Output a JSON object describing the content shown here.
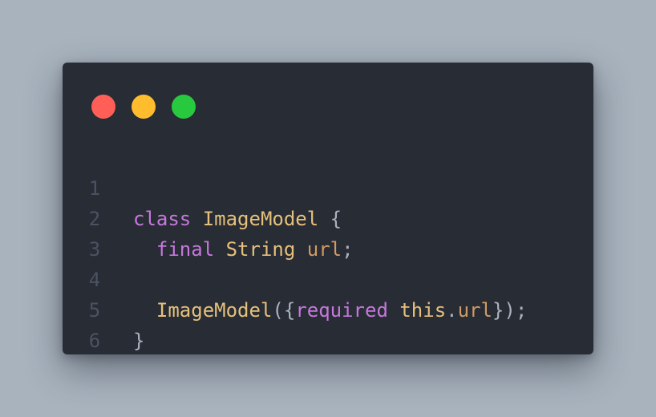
{
  "window": {
    "buttons": {
      "close_color": "#ff5f56",
      "minimize_color": "#ffbd2e",
      "maximize_color": "#27c93f"
    }
  },
  "code": {
    "lines": [
      {
        "number": "1",
        "tokens": [
          {
            "text": "class",
            "type": "keyword"
          },
          {
            "text": " ",
            "type": "plain"
          },
          {
            "text": "ImageModel",
            "type": "type"
          },
          {
            "text": " {",
            "type": "punct"
          }
        ]
      },
      {
        "number": "2",
        "tokens": [
          {
            "text": "  ",
            "type": "plain"
          },
          {
            "text": "final",
            "type": "keyword"
          },
          {
            "text": " ",
            "type": "plain"
          },
          {
            "text": "String",
            "type": "type"
          },
          {
            "text": " ",
            "type": "plain"
          },
          {
            "text": "url",
            "type": "field"
          },
          {
            "text": ";",
            "type": "punct"
          }
        ]
      },
      {
        "number": "3",
        "tokens": []
      },
      {
        "number": "4",
        "tokens": [
          {
            "text": "  ",
            "type": "plain"
          },
          {
            "text": "ImageModel",
            "type": "type"
          },
          {
            "text": "({",
            "type": "punct"
          },
          {
            "text": "required",
            "type": "keyword"
          },
          {
            "text": " ",
            "type": "plain"
          },
          {
            "text": "this",
            "type": "type"
          },
          {
            "text": ".",
            "type": "punct"
          },
          {
            "text": "url",
            "type": "field"
          },
          {
            "text": "});",
            "type": "punct"
          }
        ]
      },
      {
        "number": "5",
        "tokens": [
          {
            "text": "}",
            "type": "punct"
          }
        ]
      },
      {
        "number": "6",
        "tokens": []
      }
    ]
  },
  "colors": {
    "background": "#a8b3be",
    "editor": "#282c34",
    "keyword": "#c678dd",
    "type": "#e5c07b",
    "field": "#d19a66",
    "punct": "#abb2bf",
    "line_number": "#4b5263"
  }
}
